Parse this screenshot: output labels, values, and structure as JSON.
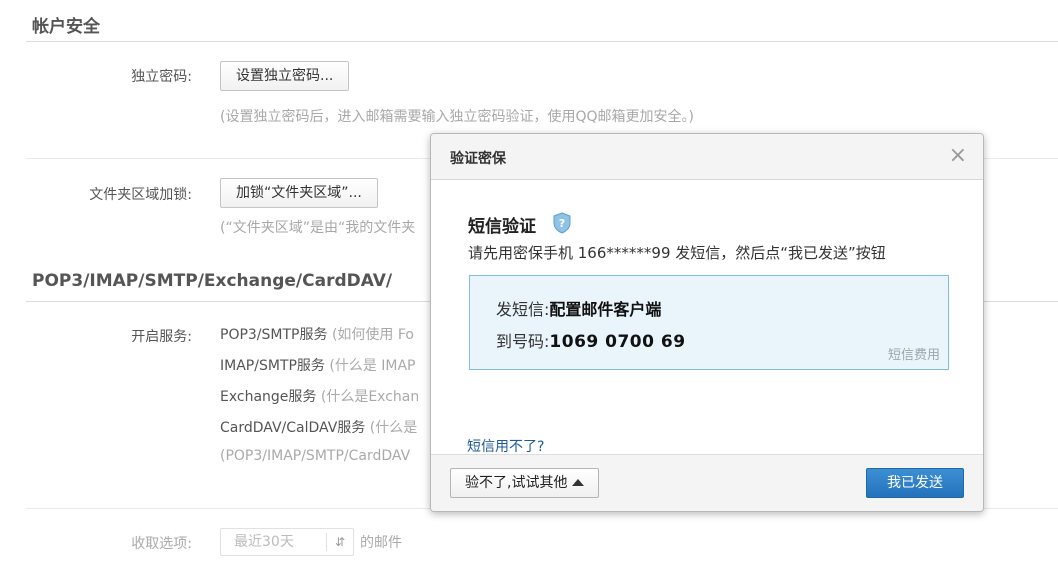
{
  "account_security": {
    "title": "帐户安全",
    "independent_password": {
      "label": "独立密码:",
      "button": "设置独立密码...",
      "hint": "(设置独立密码后，进入邮箱需要输入独立密码验证，使用QQ邮箱更加安全。)"
    },
    "folder_lock": {
      "label": "文件夹区域加锁:",
      "button": "加锁“文件夹区域”...",
      "hint": "(“文件夹区域”是由“我的文件夹"
    }
  },
  "pop_section": {
    "title": "POP3/IMAP/SMTP/Exchange/CardDAV/",
    "services_label": "开启服务:",
    "services": [
      {
        "name": "POP3/SMTP服务",
        "note": "(如何使用 Fo"
      },
      {
        "name": "IMAP/SMTP服务",
        "note": "(什么是 IMAP"
      },
      {
        "name": "Exchange服务",
        "note": "(什么是Exchan"
      },
      {
        "name": "CardDAV/CalDAV服务",
        "note": "(什么是"
      }
    ],
    "footnote": "(POP3/IMAP/SMTP/CardDAV",
    "receive_label": "收取选项:",
    "receive_select": "最近30天",
    "receive_suffix": "的邮件"
  },
  "dialog": {
    "title": "验证密保",
    "close": "×",
    "sms_title": "短信验证",
    "instruction": "请先用密保手机 166******99 发短信，然后点“我已发送”按钮",
    "send_label": "发短信:",
    "send_value": "配置邮件客户端",
    "to_label": "到号码:",
    "to_value": "1069 0700 69",
    "fee_link": "短信费用",
    "cant_use": "短信用不了?",
    "other_button": "验不了,试试其他",
    "sent_button": "我已发送"
  }
}
